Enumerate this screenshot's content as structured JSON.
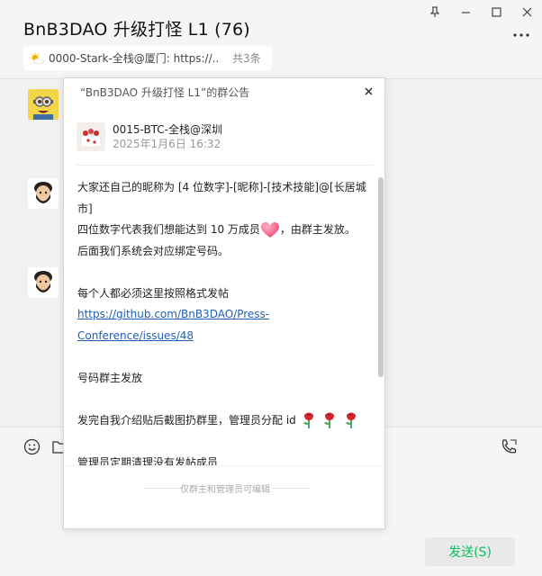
{
  "window": {
    "title": "BnB3DAO 升级打怪 L1 (76)",
    "controls": {
      "pin": "pin-icon",
      "minimize": "minimize-icon",
      "maximize": "maximize-icon",
      "close": "close-icon"
    }
  },
  "pinned": {
    "text": "0000-Stark-全栈@厦门: https://...",
    "count": "共3条"
  },
  "popup": {
    "title": "“BnB3DAO 升级打怪 L1”的群公告",
    "author": {
      "name": "0015-BTC-全栈@深圳",
      "date": "2025年1月6日 16:32"
    },
    "lines": {
      "l1a": "大家还自己的昵称为 [4 位数字]-[昵称]-[技术技能]@[长居城",
      "l1b": "市]",
      "l2a": "四位数字代表我们想能达到 10 万成员",
      "l2b": "，由群主发放。",
      "l3": "后面我们系统会对应绑定号码。",
      "l4": "每个人都必须这里按照格式发帖",
      "link_a": "https://github.com/BnB3DAO/Press-",
      "link_b": "Conference/issues/48",
      "l5": "号码群主发放",
      "l6": "发完自我介绍贴后截图扔群里，管理员分配 id",
      "l7": "管理员定期清理没有发帖成员"
    },
    "footer": "仅群主和管理员可编辑"
  },
  "input": {
    "send_label": "发送(S)"
  },
  "colors": {
    "accent": "#07c160",
    "link": "#1e5fb4"
  }
}
